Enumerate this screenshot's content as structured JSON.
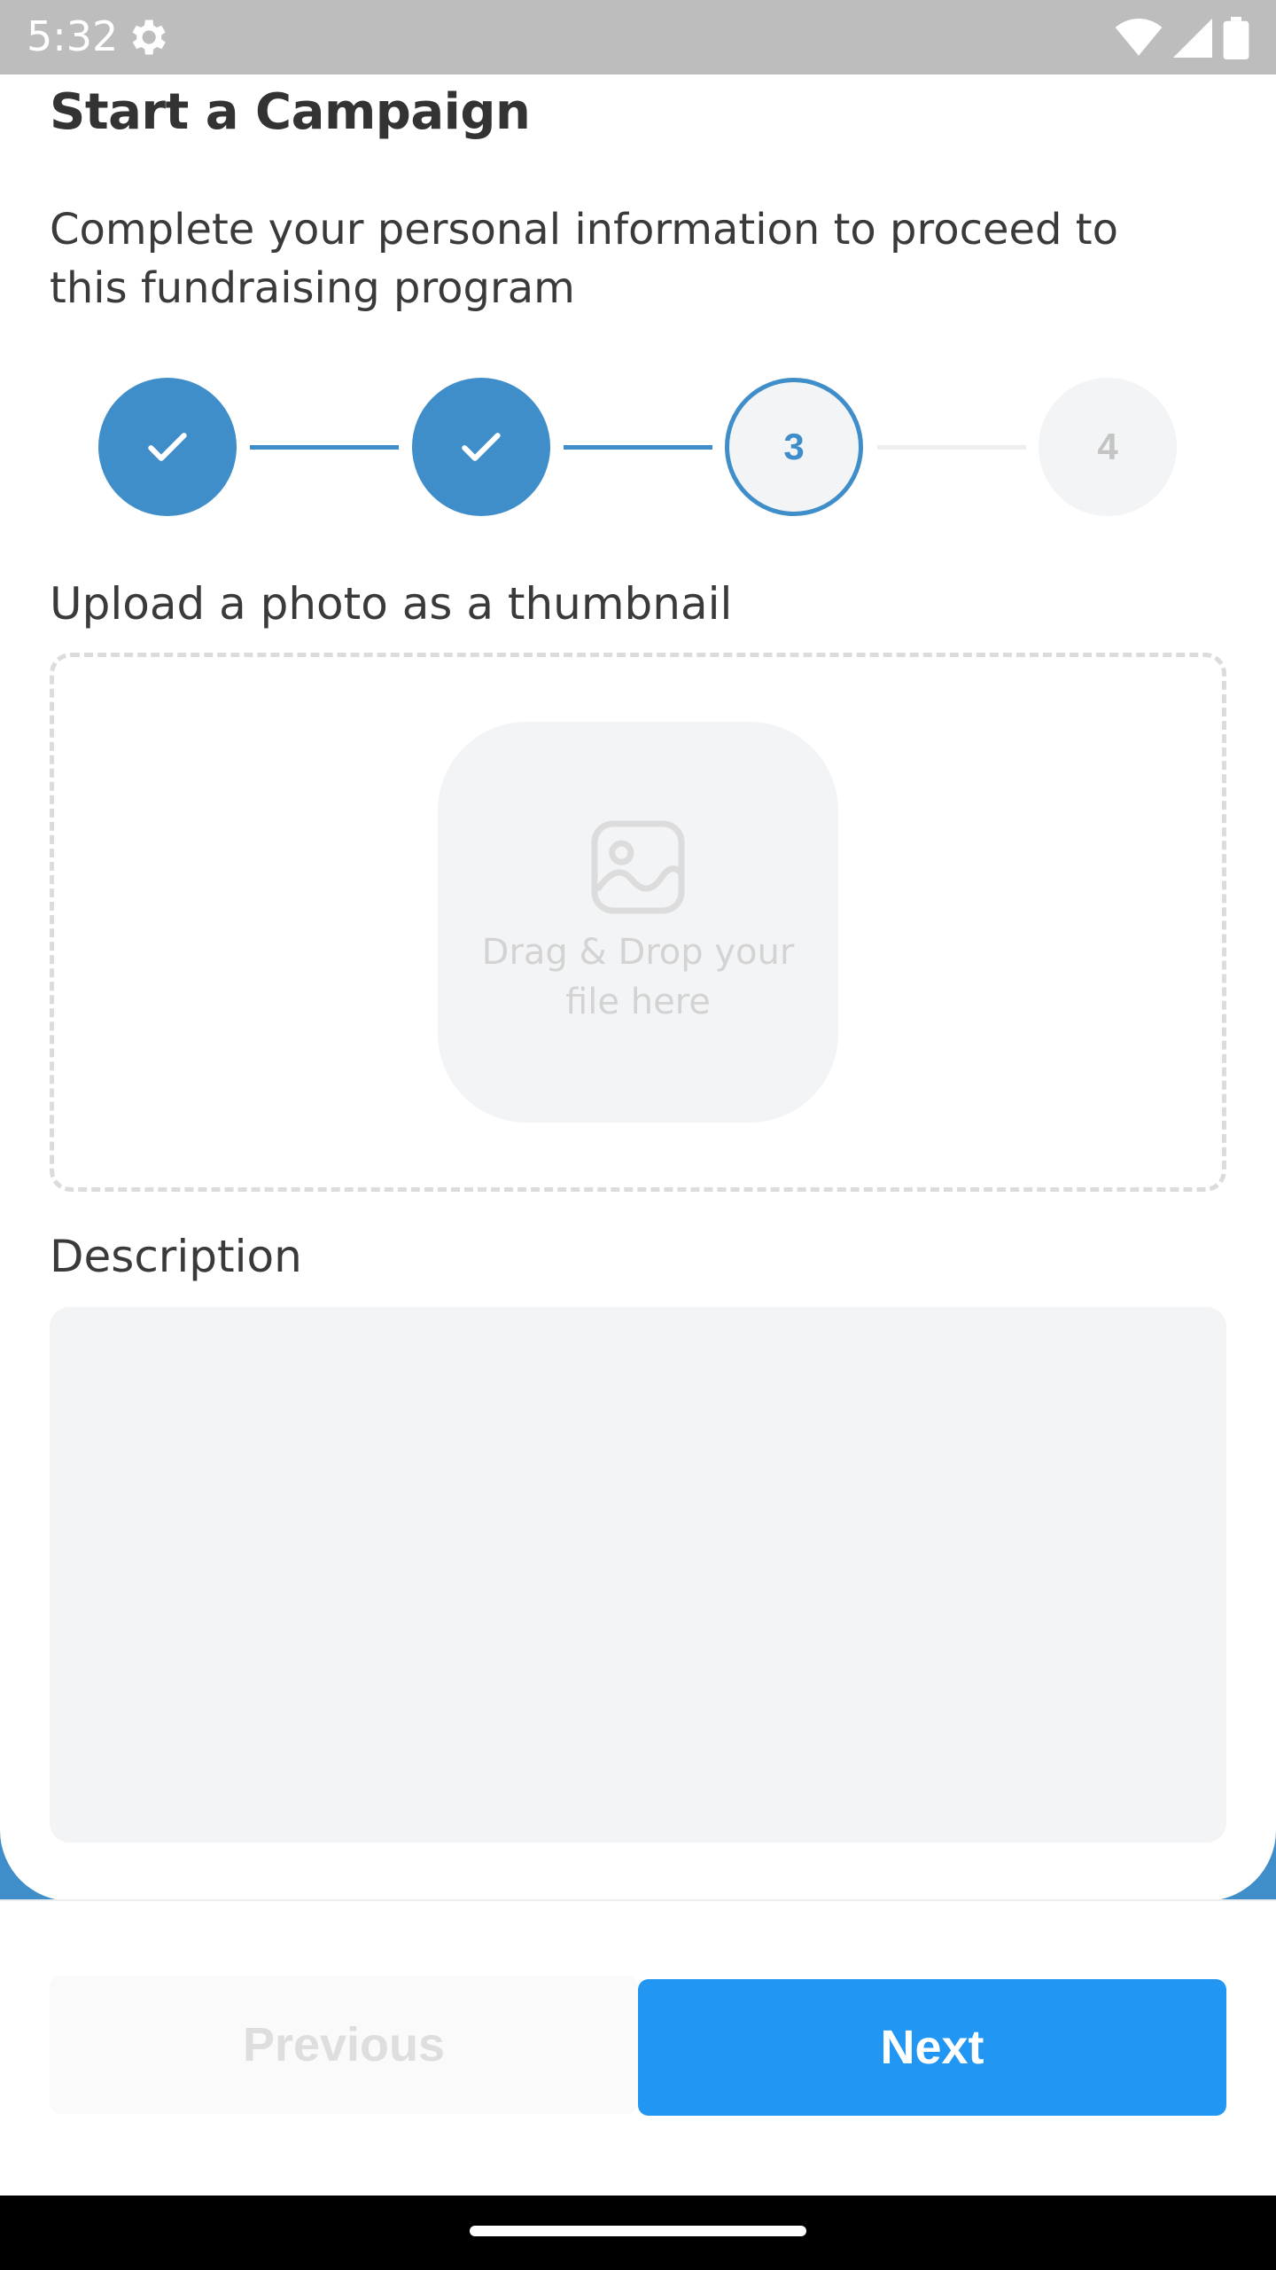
{
  "status_bar": {
    "time": "5:32",
    "icons": [
      "gear-icon",
      "wifi-icon",
      "signal-icon",
      "battery-icon"
    ]
  },
  "header": {
    "title": "Start a Campaign",
    "subtitle": "Complete your personal information to proceed to this fundraising program"
  },
  "stepper": {
    "current_step": 3,
    "total_steps": 4,
    "steps": [
      {
        "state": "completed",
        "icon": "check-icon",
        "label": ""
      },
      {
        "state": "completed",
        "icon": "check-icon",
        "label": ""
      },
      {
        "state": "current",
        "label": "3"
      },
      {
        "state": "upcoming",
        "label": "4"
      }
    ]
  },
  "upload": {
    "label": "Upload a photo as a thumbnail",
    "icon": "image-icon",
    "drop_text_line1": "Drag & Drop your",
    "drop_text_line2": "file here"
  },
  "description": {
    "label": "Description",
    "value": ""
  },
  "footer": {
    "previous_label": "Previous",
    "next_label": "Next"
  },
  "colors": {
    "primary": "#3f8ec9",
    "button": "#2196f3",
    "field_bg": "#f3f4f6",
    "status_bar": "#bdbdbd"
  }
}
